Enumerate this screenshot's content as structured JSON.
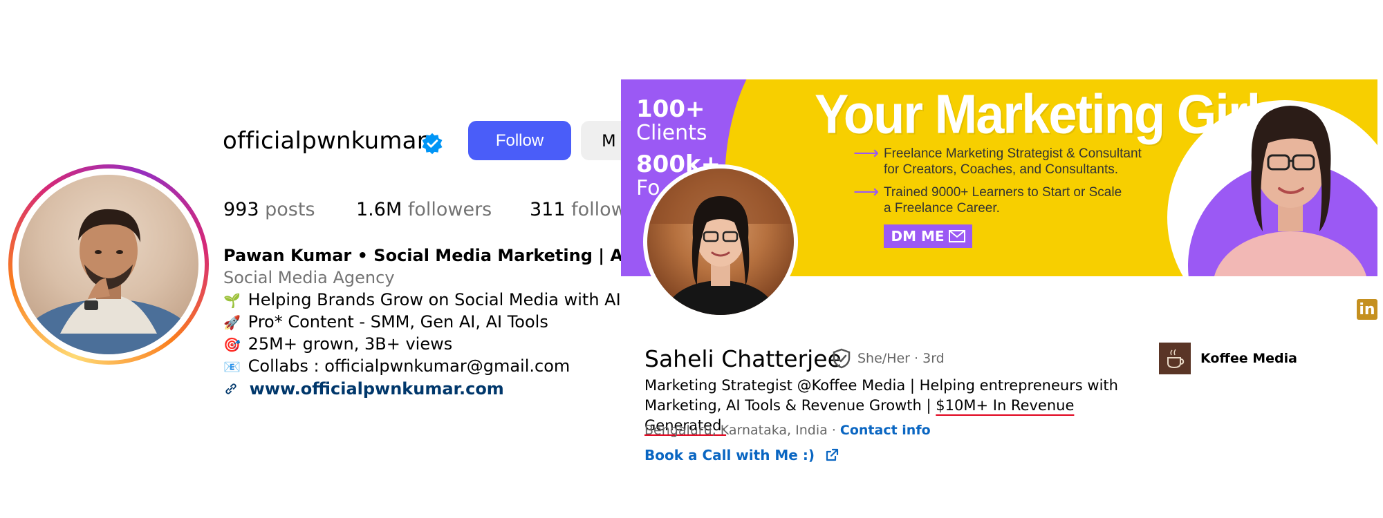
{
  "instagram": {
    "username": "officialpwnkumar",
    "follow_label": "Follow",
    "message_label_partial": "M",
    "stats": [
      {
        "value": "993",
        "label": "posts"
      },
      {
        "value": "1.6M",
        "label": "followers"
      },
      {
        "value": "311",
        "label": "follow"
      }
    ],
    "bio": {
      "name_line": "Pawan Kumar • Social Media Marketing | AI",
      "category": "Social Media Agency",
      "lines": [
        {
          "emoji": "🌱",
          "text": "Helping Brands Grow on Social Media with AI"
        },
        {
          "emoji": "🚀",
          "text": "Pro* Content - SMM, Gen AI, AI Tools"
        },
        {
          "emoji": "🎯",
          "text": "25M+ grown, 3B+ views"
        },
        {
          "emoji": "📧",
          "text": "Collabs : officialpwnkumar@gmail.com"
        }
      ],
      "link_icon": "link-icon",
      "website": "www.officialpwnkumar.com"
    },
    "colors": {
      "follow_button": "#4a5df9",
      "link": "#00376b",
      "verified": "#0095f6"
    }
  },
  "linkedin": {
    "banner": {
      "stat1_value": "100+",
      "stat1_label": "Clients",
      "stat2_value": "800k+",
      "stat2_label": "Fo",
      "title": "Your Marketing Girl",
      "points": [
        {
          "line1": "Freelance Marketing Strategist & Consultant",
          "line2": "for Creators, Coaches, and Consultants."
        },
        {
          "line1": "Trained 9000+ Learners to Start or Scale",
          "line2": "a Freelance Career."
        }
      ],
      "cta": "DM ME",
      "colors": {
        "yellow": "#f7cf00",
        "purple": "#9b59f4"
      }
    },
    "profile": {
      "name": "Saheli Chatterjee",
      "pronouns_degree": "She/Her · 3rd",
      "headline_part1": "Marketing Strategist @Koffee Media | Helping entrepreneurs with Marketing, AI Tools & Revenue Growth | ",
      "headline_highlight": "$10M+ In Revenue Generated.",
      "location": "Bengaluru, Karnataka, India",
      "separator": " · ",
      "contact_info": "Contact info",
      "book_link": "Book a Call with Me :)",
      "company": "Koffee Media"
    },
    "colors": {
      "link": "#0a66c2",
      "linkedin_badge": "#c5901f",
      "underline": "#e0001b"
    }
  }
}
